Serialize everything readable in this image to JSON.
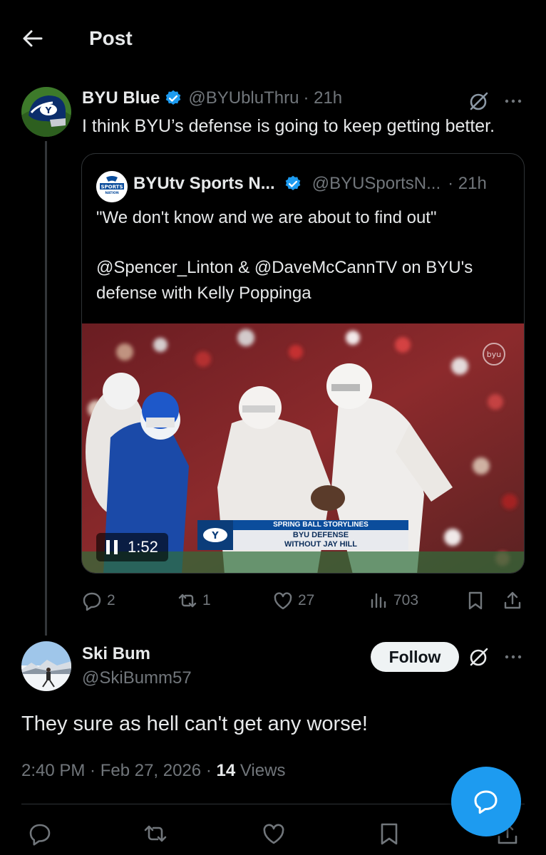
{
  "header": {
    "title": "Post"
  },
  "parent": {
    "name": "BYU Blue",
    "handle": "@BYUbluThru",
    "time": "· 21h",
    "text": "I think BYU’s defense is going to keep getting better."
  },
  "quote": {
    "name": "BYUtv Sports N...",
    "handle": "@BYUSportsN...",
    "time": "· 21h",
    "line1": "\"We don't know and we are about to find out\"",
    "line2": "@Spencer_Linton & @DaveMcCannTV on BYU's defense with Kelly Poppinga",
    "video": {
      "duration": "1:52",
      "chyron_top": "SPRING BALL STORYLINES",
      "chyron_line1": "BYU DEFENSE",
      "chyron_line2": "WITHOUT JAY HILL"
    }
  },
  "actions": {
    "replies": "2",
    "reposts": "1",
    "likes": "27",
    "views": "703"
  },
  "reply": {
    "name": "Ski Bum",
    "handle": "@SkiBumm57",
    "follow_label": "Follow",
    "text": "They sure as hell can't get any worse!",
    "time": "2:40 PM · Feb 27, 2026 · ",
    "views_count": "14",
    "views_label": " Views"
  },
  "colors": {
    "accent": "#1d9bf0",
    "background": "#000000",
    "muted": "#71767b",
    "text": "#e7e9ea"
  }
}
